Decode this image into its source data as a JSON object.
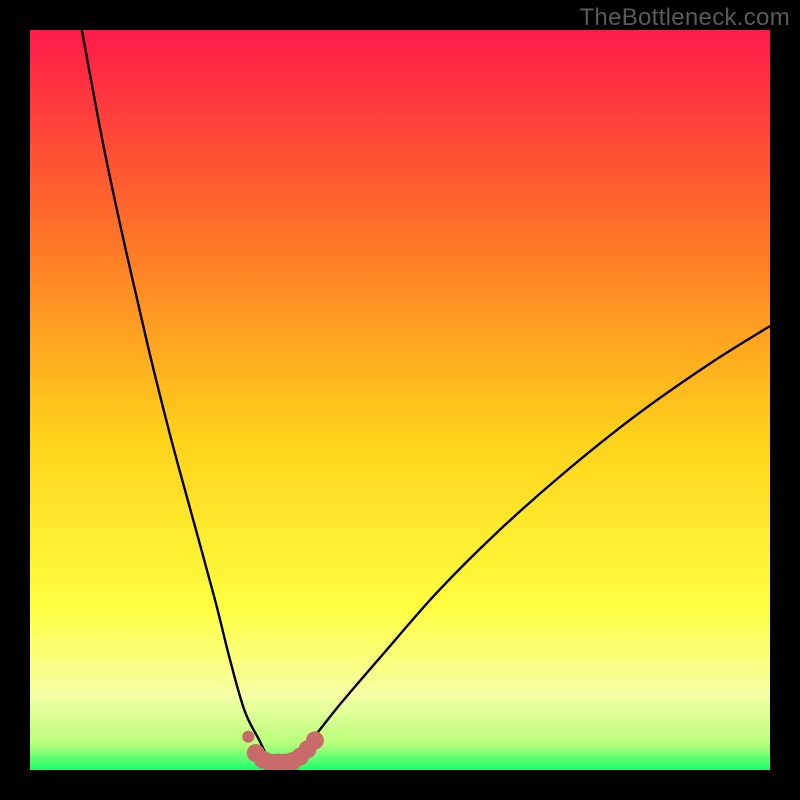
{
  "watermark": "TheBottleneck.com",
  "colors": {
    "frame_bg": "#000000",
    "gradient_top": "#ff1a4a",
    "gradient_mid1": "#ff6a2a",
    "gradient_mid2": "#ffd21a",
    "gradient_mid3": "#ffff40",
    "gradient_low": "#f6ffa6",
    "gradient_green": "#1aff6a",
    "curve": "#000000",
    "marker": "#c96a6a"
  },
  "chart_data": {
    "type": "line",
    "title": "",
    "xlabel": "",
    "ylabel": "",
    "xlim": [
      0,
      100
    ],
    "ylim": [
      0,
      100
    ],
    "series": [
      {
        "name": "bottleneck-curve",
        "x": [
          7,
          10,
          13,
          16,
          19,
          22,
          25,
          27,
          29,
          31,
          32,
          33,
          34,
          35,
          36,
          38,
          42,
          48,
          55,
          63,
          72,
          82,
          92,
          100
        ],
        "y": [
          100,
          84,
          70,
          57,
          45,
          34,
          23,
          15,
          8,
          4,
          2,
          1,
          1,
          1,
          2,
          4,
          9,
          16,
          24,
          32,
          40,
          48,
          55,
          60
        ]
      }
    ],
    "markers": {
      "name": "highlight-dots",
      "x": [
        29.5,
        30.5,
        31.5,
        32.5,
        33.5,
        34.5,
        35.5,
        36.5,
        37.5,
        38.5
      ],
      "y": [
        4.5,
        2.3,
        1.4,
        1.0,
        1.0,
        1.0,
        1.2,
        1.8,
        2.8,
        4.0
      ]
    },
    "gradient_stops": [
      {
        "offset": 0.0,
        "color": "#ff1a4a"
      },
      {
        "offset": 0.25,
        "color": "#ff6a2a"
      },
      {
        "offset": 0.55,
        "color": "#ffd21a"
      },
      {
        "offset": 0.78,
        "color": "#ffff40"
      },
      {
        "offset": 0.9,
        "color": "#f6ffa6"
      },
      {
        "offset": 0.965,
        "color": "#b6ff7a"
      },
      {
        "offset": 1.0,
        "color": "#1aff6a"
      }
    ]
  }
}
